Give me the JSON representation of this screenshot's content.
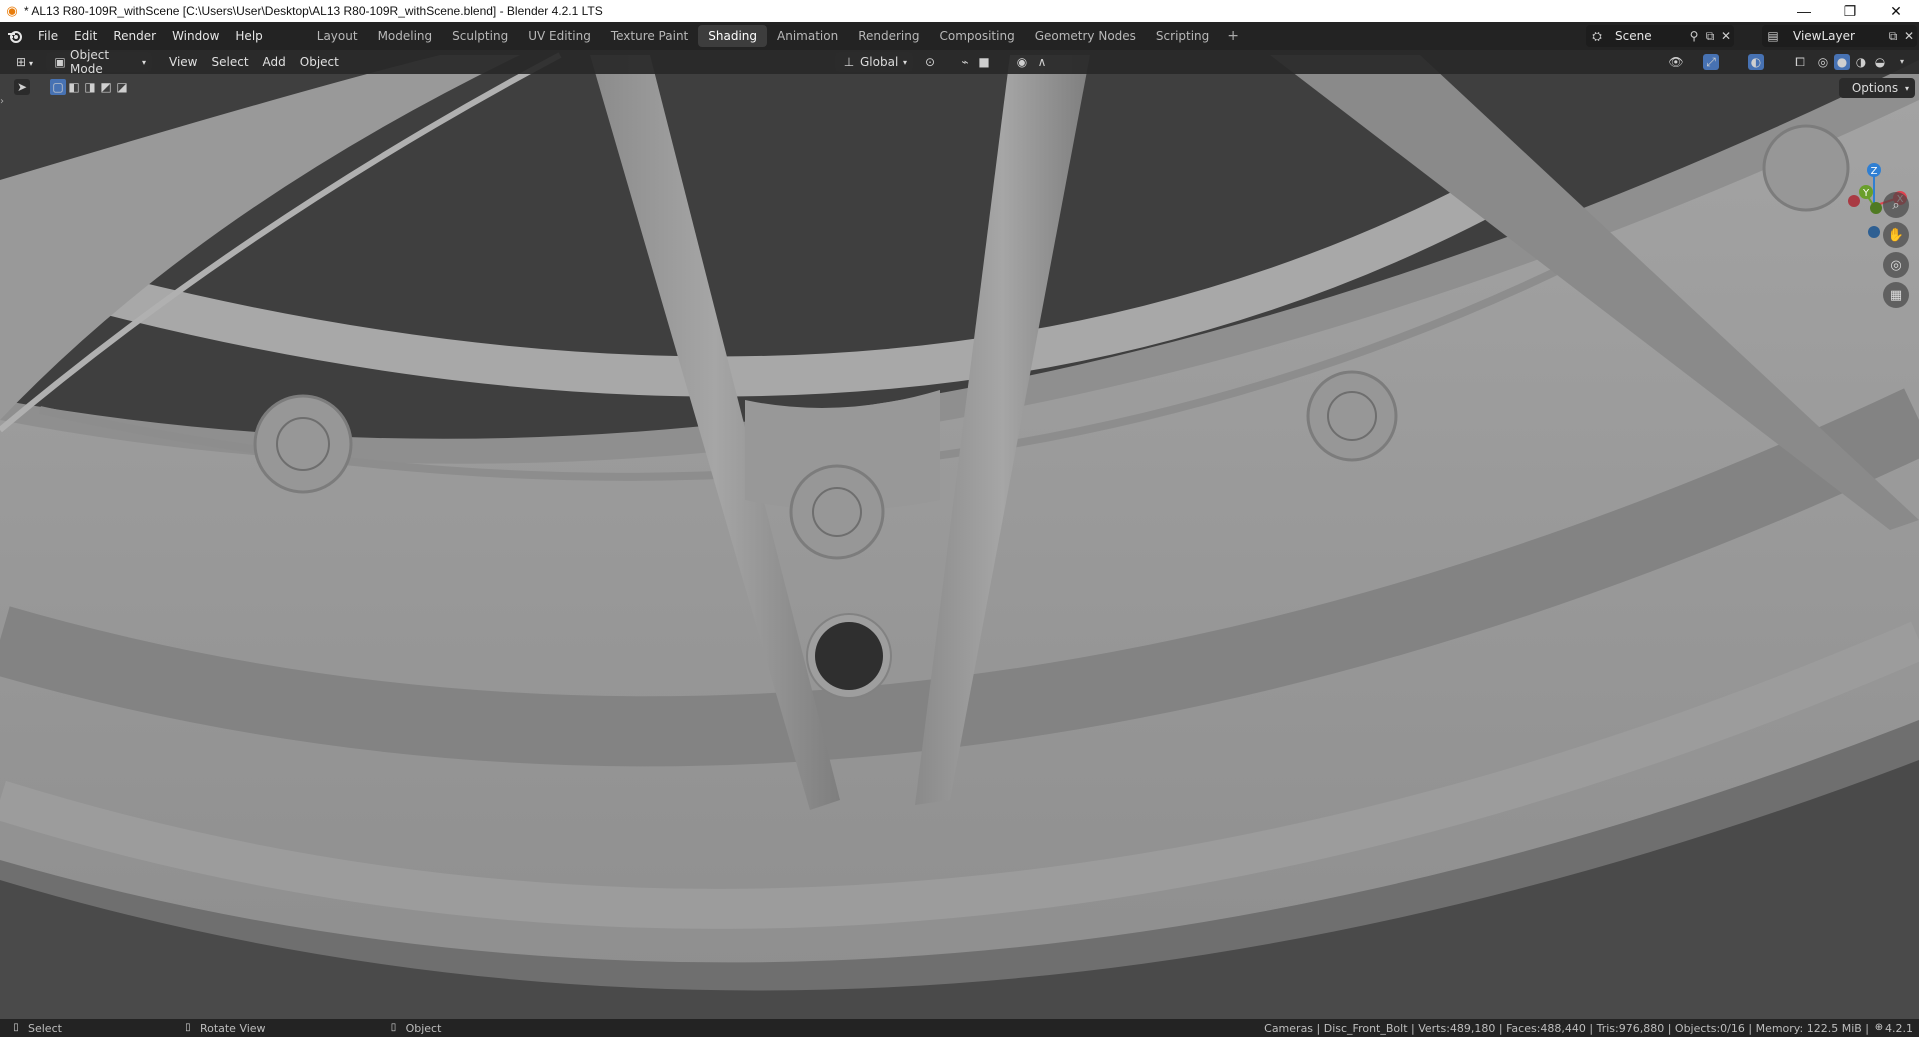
{
  "window": {
    "title": "* AL13 R80-109R_withScene [C:\\Users\\User\\Desktop\\AL13 R80-109R_withScene.blend] - Blender 4.2.1 LTS",
    "minimize": "—",
    "maximize": "❐",
    "close": "✕"
  },
  "menus": [
    "File",
    "Edit",
    "Render",
    "Window",
    "Help"
  ],
  "workspaces": [
    "Layout",
    "Modeling",
    "Sculpting",
    "UV Editing",
    "Texture Paint",
    "Shading",
    "Animation",
    "Rendering",
    "Compositing",
    "Geometry Nodes",
    "Scripting"
  ],
  "active_workspace": "Shading",
  "scene": {
    "label": "Scene",
    "view_layer": "ViewLayer"
  },
  "viewport_header": {
    "mode": "Object Mode",
    "menus": [
      "View",
      "Select",
      "Add",
      "Object"
    ],
    "transform_orientation": "Global",
    "options": "Options"
  },
  "gizmo": {
    "z": "Z",
    "y": "Y",
    "x": "X"
  },
  "statusbar": {
    "left": [
      {
        "icon": "mouse-left-icon",
        "label": "Select"
      },
      {
        "icon": "mouse-middle-icon",
        "label": "Rotate View"
      },
      {
        "icon": "mouse-right-icon",
        "label": "Object"
      }
    ],
    "stats": "Cameras | Disc_Front_Bolt | Verts:489,180 | Faces:488,440 | Tris:976,880 | Objects:0/16 | Memory: 122.5 MiB | ",
    "version": "4.2.1"
  },
  "colors": {
    "accent": "#4772b3",
    "gizmo_x": "#e0424f",
    "gizmo_y": "#6a9f2b",
    "gizmo_z": "#2f7fd3",
    "mesh": "#9a9a9a",
    "background": "#3d3d3d"
  }
}
